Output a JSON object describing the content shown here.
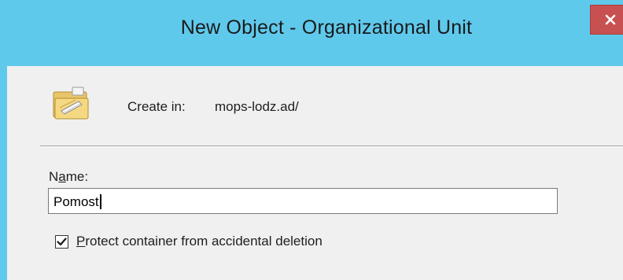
{
  "window": {
    "title": "New Object - Organizational Unit",
    "close_glyph": "x",
    "title_bar_color": "#5fc9ec",
    "close_button_color": "#c75050"
  },
  "create_in": {
    "label": "Create in:",
    "value": "mops-lodz.ad/",
    "icon": "organizational-unit-folder-icon"
  },
  "name_field": {
    "label_first": "N",
    "label_underlined": "a",
    "label_rest": "me:",
    "value": "Pomost"
  },
  "protect_option": {
    "checked": true,
    "label_underlined": "P",
    "label_rest": "rotect container from accidental deletion"
  }
}
